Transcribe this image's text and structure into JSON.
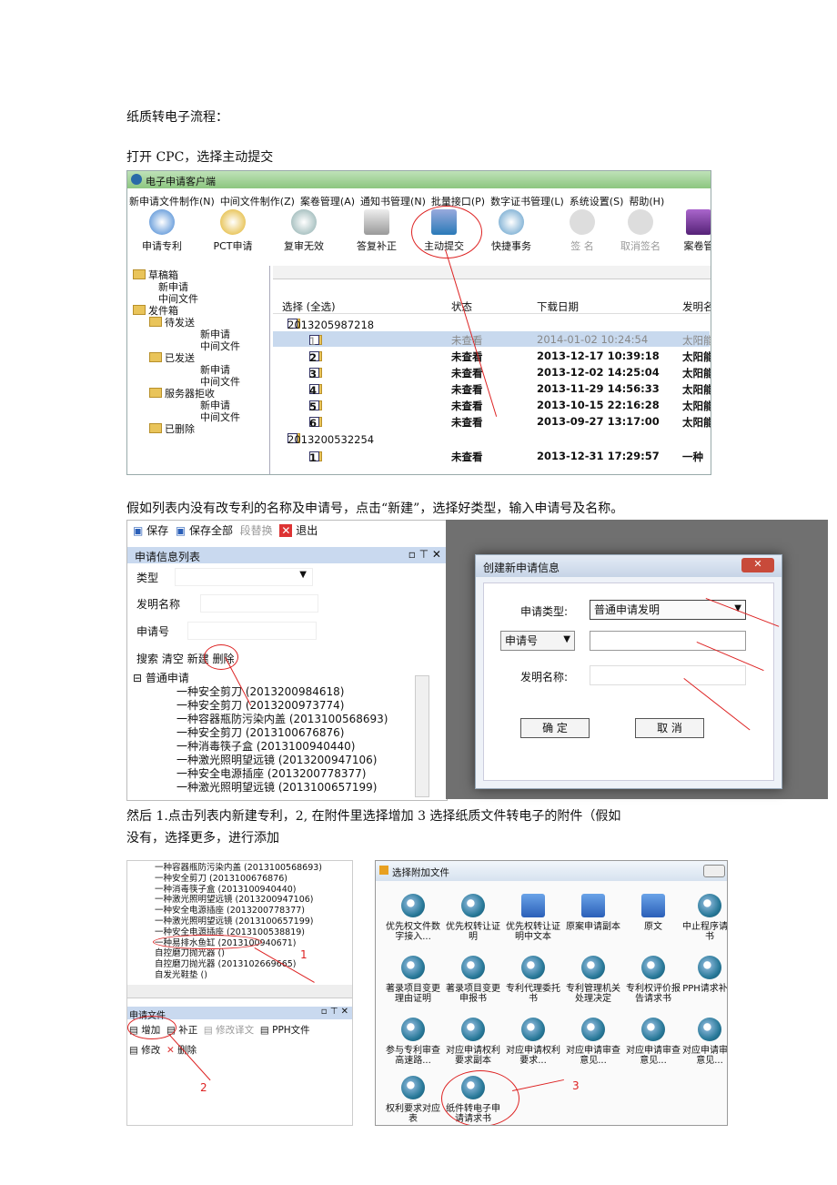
{
  "paragraphs": {
    "p1": "纸质转电子流程：",
    "p2": "打开 CPC，选择主动提交",
    "p3": "假如列表内没有改专利的名称及申请号，点击“新建”，选择好类型，输入申请号及名称。",
    "p4a": "然后 1.点击列表内新建专利，2, 在附件里选择增加   3 选择纸质文件转电子的附件（假如",
    "p4b": "没有，选择更多，进行添加"
  },
  "shot1": {
    "title": "电子申请客户端",
    "menu": [
      "新申请文件制作(N)",
      "中间文件制作(Z)",
      "案卷管理(A)",
      "通知书管理(N)",
      "批量接口(P)",
      "数字证书管理(L)",
      "系统设置(S)",
      "帮助(H)"
    ],
    "toolbar": [
      "申请专利",
      "PCT申请",
      "复审无效",
      "答复补正",
      "主动提交",
      "快捷事务",
      "签 名",
      "取消签名",
      "案卷管"
    ],
    "tree": [
      "草稿箱",
      "新申请",
      "中间文件",
      "发件箱",
      "待发送",
      "新申请",
      "中间文件",
      "已发送",
      "新申请",
      "中间文件",
      "服务器拒收",
      "新申请",
      "中间文件",
      "已删除"
    ],
    "columns": [
      "选择 (全选)",
      "状态",
      "下载日期",
      "发明名"
    ],
    "group1": "2013205987218",
    "rows": [
      {
        "id": "1",
        "status": "未查看",
        "date": "2014-01-02 10:24:54",
        "name": "太阳能"
      },
      {
        "id": "2",
        "status": "未查看",
        "date": "2013-12-17 10:39:18",
        "name": "太阳能"
      },
      {
        "id": "3",
        "status": "未查看",
        "date": "2013-12-02 14:25:04",
        "name": "太阳能"
      },
      {
        "id": "4",
        "status": "未查看",
        "date": "2013-11-29 14:56:33",
        "name": "太阳能"
      },
      {
        "id": "5",
        "status": "未查看",
        "date": "2013-10-15 22:16:28",
        "name": "太阳能"
      },
      {
        "id": "6",
        "status": "未查看",
        "date": "2013-09-27 13:17:00",
        "name": "太阳能"
      }
    ],
    "group2": "2013200532254",
    "row_last": {
      "id": "1",
      "status": "未查看",
      "date": "2013-12-31 17:29:57",
      "name": "一种"
    }
  },
  "shot2": {
    "toolbar": [
      "保存",
      "保存全部",
      "段替换",
      "退出"
    ],
    "panel_title": "申请信息列表",
    "fields": [
      "类型",
      "发明名称",
      "申请号"
    ],
    "actions": [
      "搜索",
      "清空",
      "新建",
      "删除"
    ],
    "root": "普通申请",
    "items": [
      "一种安全剪刀 (2013200984618)",
      "一种安全剪刀 (2013200973774)",
      "一种容器瓶防污染内盖 (2013100568693)",
      "一种安全剪刀 (2013100676876)",
      "一种消毒筷子盒 (2013100940440)",
      "一种激光照明望远镜 (2013200947106)",
      "一种安全电源插座 (2013200778377)",
      "一种激光照明望远镜 (2013100657199)"
    ]
  },
  "dialog": {
    "title": "创建新申请信息",
    "type_label": "申请类型:",
    "type_value": "普通申请发明",
    "number_select": "申请号",
    "name_label": "发明名称:",
    "ok": "确 定",
    "cancel": "取 消"
  },
  "shot3": {
    "items": [
      "一种容器瓶防污染内盖 (2013100568693)",
      "一种安全剪刀 (2013100676876)",
      "一种消毒筷子盒 (2013100940440)",
      "一种激光照明望远镜 (2013200947106)",
      "一种安全电源插座 (2013200778377)",
      "一种激光照明望远镜 (2013100657199)",
      "一种安全电源插座 (2013100538819)",
      "一种易排水鱼缸 (2013100940671)",
      "自控磨刀抛光器 ()",
      "自控磨刀抛光器 (2013102669665)",
      "自发光鞋垫 ()"
    ],
    "panel": "申请文件",
    "btns": [
      "增加",
      "补正",
      "修改译文",
      "PPH文件",
      "修改",
      "删除"
    ],
    "annot": [
      "1",
      "2",
      "3"
    ]
  },
  "attach": {
    "title": "选择附加文件",
    "icons": [
      "优先权文件数字接入...",
      "优先权转让证明",
      "优先权转让证明中文本",
      "原案申请副本",
      "原文",
      "中止程序请求书",
      "著录项目变更理由证明",
      "著录项目变更申报书",
      "专利代理委托书",
      "专利管理机关处理决定",
      "专利权评价报告请求书",
      "PPH请求补书",
      "参与专利审查高速路...",
      "对应申请权利要求副本",
      "对应申请权利要求...",
      "对应申请审查意见...",
      "对应申请审查意见...",
      "对应申请审查意见...",
      "权利要求对应表",
      "纸件转电子申请请求书"
    ]
  }
}
